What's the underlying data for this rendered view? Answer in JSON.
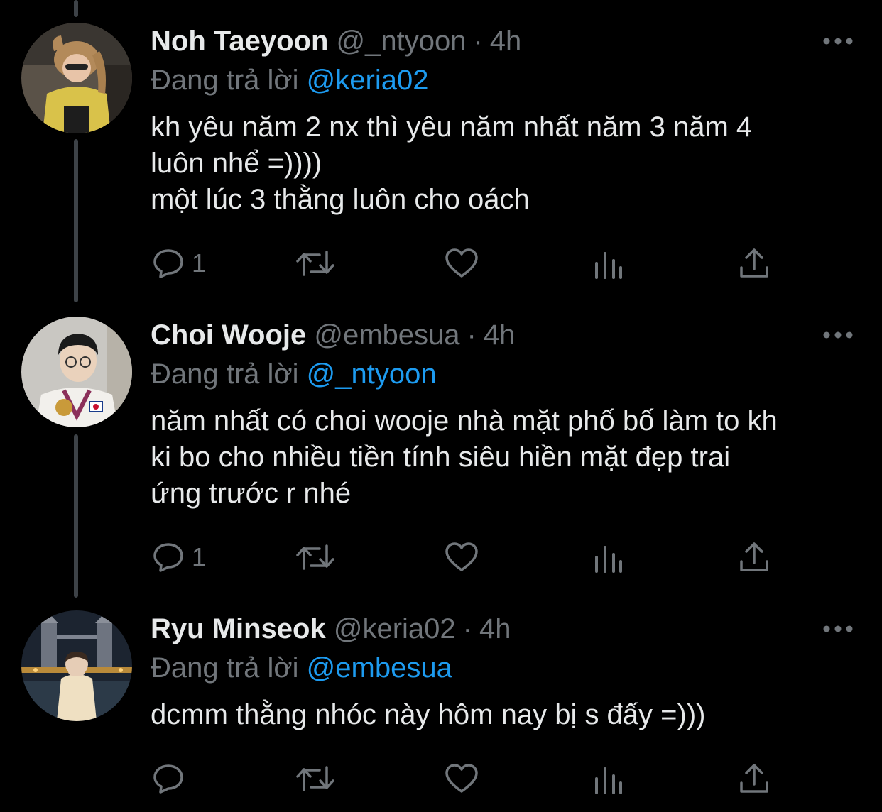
{
  "colors": {
    "background": "#000000",
    "text": "#e7e9ea",
    "secondary": "#71767b",
    "mention": "#1d9bf0",
    "thread_line": "#3d4247"
  },
  "reply_prefix": "Đang trả lời",
  "tweets": [
    {
      "display_name": "Noh Taeyoon",
      "handle": "@_ntyoon",
      "separator": "·",
      "time": "4h",
      "replying_to": "@keria02",
      "lines": [
        "kh yêu năm 2 nx thì yêu năm nhất năm 3 năm 4",
        "luôn nhể =))))",
        "một lúc 3 thằng luôn cho oách"
      ],
      "reply_count": "1",
      "icons": [
        "reply-icon",
        "retweet-icon",
        "like-icon",
        "analytics-icon",
        "share-icon",
        "more-icon"
      ]
    },
    {
      "display_name": "Choi Wooje",
      "handle": "@embesua",
      "separator": "·",
      "time": "4h",
      "replying_to": "@_ntyoon",
      "lines": [
        "năm nhất có choi wooje nhà mặt phố bố làm to kh",
        "ki bo cho nhiều tiền tính siêu hiền mặt đẹp trai",
        "ứng trước r nhé"
      ],
      "reply_count": "1",
      "icons": [
        "reply-icon",
        "retweet-icon",
        "like-icon",
        "analytics-icon",
        "share-icon",
        "more-icon"
      ]
    },
    {
      "display_name": "Ryu Minseok",
      "handle": "@keria02",
      "separator": "·",
      "time": "4h",
      "replying_to": "@embesua",
      "lines": [
        "dcmm thằng nhóc này hôm nay bị s đấy =)))"
      ],
      "reply_count": "",
      "icons": [
        "reply-icon",
        "retweet-icon",
        "like-icon",
        "analytics-icon",
        "share-icon",
        "more-icon"
      ]
    }
  ]
}
